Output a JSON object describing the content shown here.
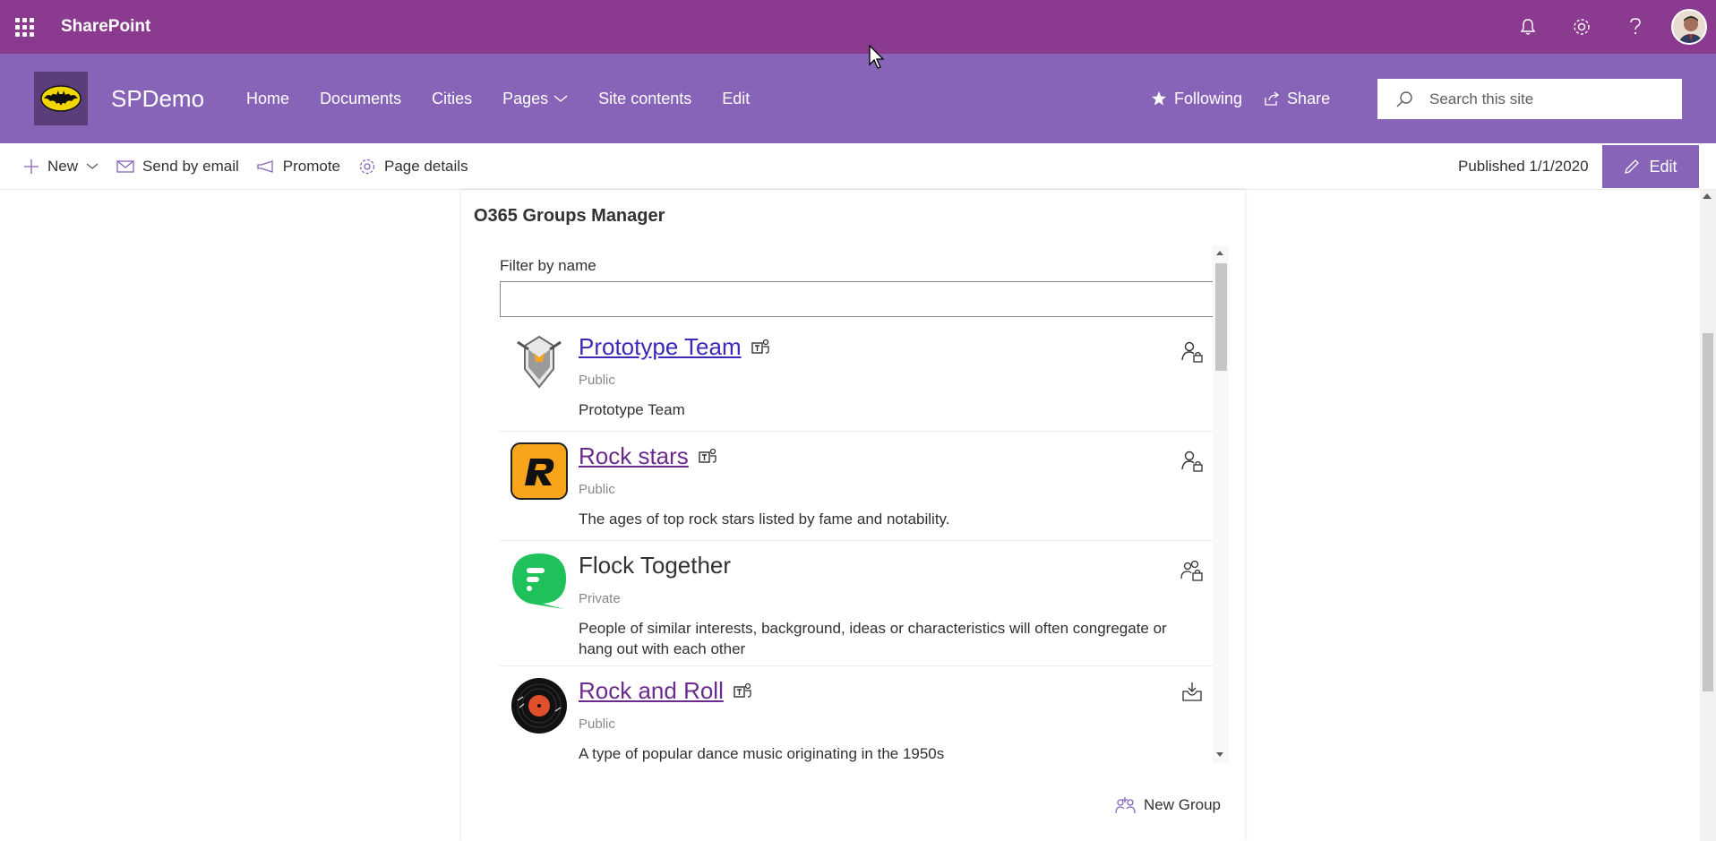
{
  "suite": {
    "title": "SharePoint"
  },
  "site": {
    "title": "SPDemo",
    "nav": [
      "Home",
      "Documents",
      "Cities",
      "Pages",
      "Site contents",
      "Edit"
    ],
    "following_label": "Following",
    "share_label": "Share",
    "search_placeholder": "Search this site"
  },
  "commands": {
    "new_label": "New",
    "send_label": "Send by email",
    "promote_label": "Promote",
    "details_label": "Page details",
    "published": "Published 1/1/2020",
    "edit_label": "Edit"
  },
  "webpart": {
    "title": "O365 Groups Manager",
    "filter_label": "Filter by name",
    "filter_value": "",
    "new_group_label": "New Group",
    "groups": [
      {
        "name": "Prototype Team",
        "privacy": "Public",
        "description": "Prototype Team",
        "teams": true,
        "action_icon": "person-lock-icon"
      },
      {
        "name": "Rock stars",
        "privacy": "Public",
        "description": "The ages of top rock stars listed by fame and notability.",
        "teams": true,
        "action_icon": "person-lock-icon"
      },
      {
        "name": "Flock Together",
        "privacy": "Private",
        "description": "People of similar interests, background, ideas or characteristics will often congregate or hang out with each other",
        "teams": false,
        "action_icon": "people-lock-icon"
      },
      {
        "name": "Rock and Roll",
        "privacy": "Public",
        "description": "A type of popular dance music originating in the 1950s",
        "teams": true,
        "action_icon": "inbox-icon"
      }
    ]
  },
  "colors": {
    "suitebar": "#8a3a8f",
    "sitehead": "#8764b8",
    "link": "#3a28b8",
    "visited": "#6b2a8e"
  }
}
